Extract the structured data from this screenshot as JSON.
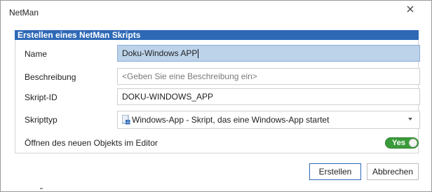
{
  "window": {
    "title": "NetMan"
  },
  "section": {
    "title": "Erstellen eines NetMan Skripts"
  },
  "form": {
    "name": {
      "label": "Name",
      "value": "Doku-Windows APP"
    },
    "description": {
      "label": "Beschreibung",
      "placeholder": "<Geben Sie eine Beschreibung ein>"
    },
    "script_id": {
      "label": "Skript-ID",
      "value": "DOKU-WINDOWS_APP"
    },
    "script_type": {
      "label": "Skripttyp",
      "selected": "Windows-App - Skript, das eine Windows-App startet",
      "icon": "windows-app-icon"
    },
    "open_in_editor": {
      "label": "Öffnen des neuen Objekts im Editor",
      "toggle_text": "Yes",
      "enabled": true
    }
  },
  "buttons": {
    "create": "Erstellen",
    "cancel": "Abbrechen"
  },
  "colors": {
    "section_header": "#2e69b6",
    "active_field": "#bcd3ea",
    "toggle_on": "#3a9b3a"
  }
}
